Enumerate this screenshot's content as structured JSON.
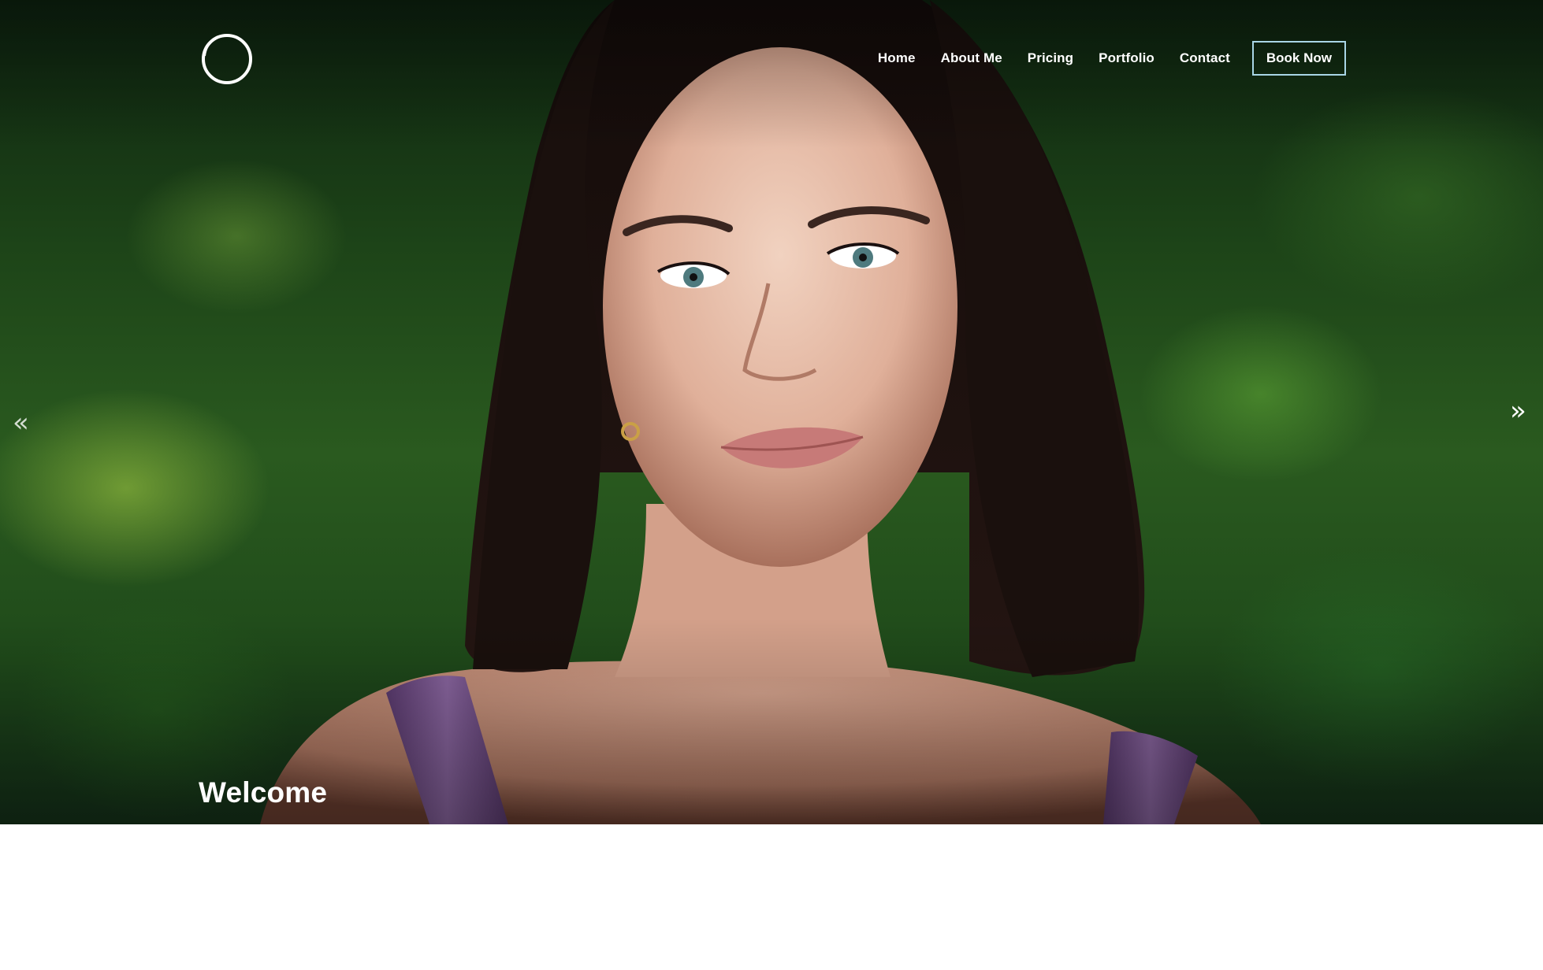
{
  "header": {
    "logo_icon": "circle-ring-logo-icon"
  },
  "nav": {
    "items": [
      {
        "label": "Home"
      },
      {
        "label": "About Me"
      },
      {
        "label": "Pricing"
      },
      {
        "label": "Portfolio"
      },
      {
        "label": "Contact"
      }
    ],
    "cta_label": "Book Now"
  },
  "hero": {
    "heading": "Welcome",
    "prev_icon": "double-chevron-left-icon",
    "prev_glyph": "«",
    "next_icon": "double-chevron-right-icon",
    "next_glyph": "»"
  },
  "colors": {
    "cta_border": "#a9d6e6",
    "text": "#ffffff",
    "page_background": "#ffffff"
  }
}
